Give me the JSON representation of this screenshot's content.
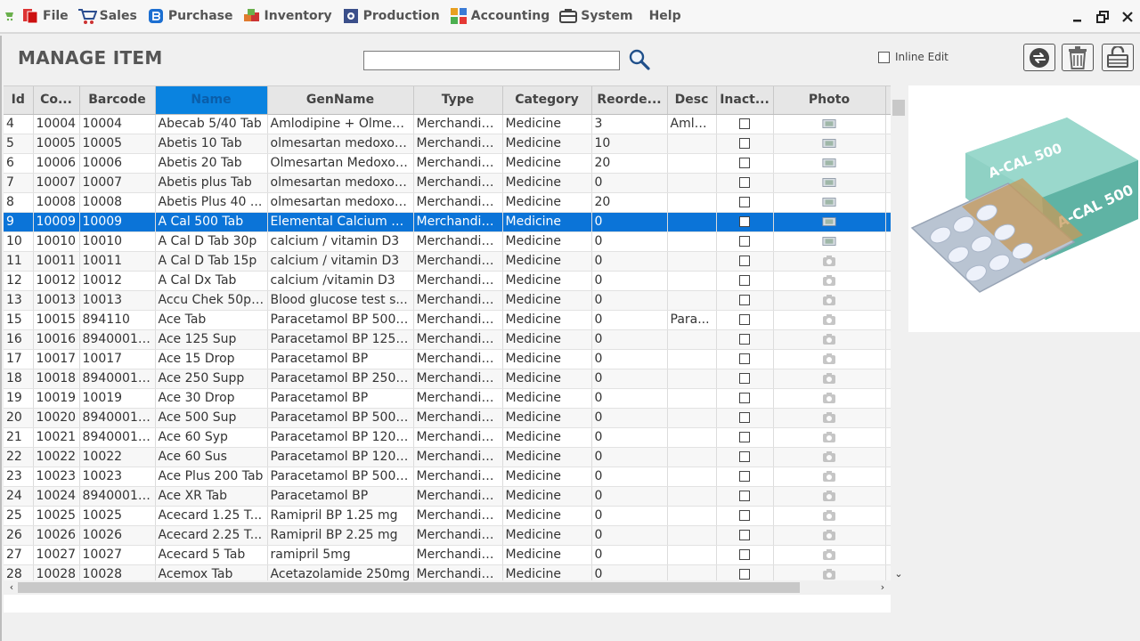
{
  "menu": {
    "items": [
      {
        "label": "File",
        "icon": "file-icon"
      },
      {
        "label": "Sales",
        "icon": "cart-icon"
      },
      {
        "label": "Purchase",
        "icon": "purchase-icon"
      },
      {
        "label": "Inventory",
        "icon": "inventory-icon"
      },
      {
        "label": "Production",
        "icon": "production-icon"
      },
      {
        "label": "Accounting",
        "icon": "accounting-icon"
      },
      {
        "label": "System",
        "icon": "system-icon"
      },
      {
        "label": "Help",
        "icon": ""
      }
    ]
  },
  "header": {
    "title": "MANAGE ITEM",
    "search_value": "",
    "inline_edit_label": "Inline Edit"
  },
  "grid": {
    "columns": [
      "Id",
      "Co...",
      "Barcode",
      "Name",
      "GenName",
      "Type",
      "Category",
      "Reorde...",
      "Desc",
      "Inact...",
      "Photo"
    ],
    "rows": [
      {
        "id": "4",
        "code": "10004",
        "barcode": "10004",
        "name": "Abecab 5/40 Tab",
        "gen": "Amlodipine + Olmesa...",
        "type": "Merchandis...",
        "cat": "Medicine",
        "reorder": "3",
        "desc": "Amlo...",
        "photo": "thumb"
      },
      {
        "id": "5",
        "code": "10005",
        "barcode": "10005",
        "name": "Abetis 10 Tab",
        "gen": "olmesartan medoxomil",
        "type": "Merchandis...",
        "cat": "Medicine",
        "reorder": "10",
        "desc": "",
        "photo": "thumb"
      },
      {
        "id": "6",
        "code": "10006",
        "barcode": "10006",
        "name": "Abetis 20 Tab",
        "gen": "Olmesartan Medoxomil",
        "type": "Merchandis...",
        "cat": "Medicine",
        "reorder": "20",
        "desc": "",
        "photo": "thumb"
      },
      {
        "id": "7",
        "code": "10007",
        "barcode": "10007",
        "name": "Abetis plus Tab",
        "gen": "olmesartan medoxomil",
        "type": "Merchandis...",
        "cat": "Medicine",
        "reorder": "0",
        "desc": "",
        "photo": "thumb"
      },
      {
        "id": "8",
        "code": "10008",
        "barcode": "10008",
        "name": "Abetis Plus 40 ...",
        "gen": "olmesartan medoxom...",
        "type": "Merchandis...",
        "cat": "Medicine",
        "reorder": "20",
        "desc": "",
        "photo": "thumb"
      },
      {
        "id": "9",
        "code": "10009",
        "barcode": "10009",
        "name": "A Cal 500 Tab",
        "gen": "Elemental Calcium 50...",
        "type": "Merchandis...",
        "cat": "Medicine",
        "reorder": "0",
        "desc": "",
        "photo": "thumb",
        "selected": true
      },
      {
        "id": "10",
        "code": "10010",
        "barcode": "10010",
        "name": "A Cal D Tab 30p",
        "gen": "calcium / vitamin D3",
        "type": "Merchandis...",
        "cat": "Medicine",
        "reorder": "0",
        "desc": "",
        "photo": "thumb"
      },
      {
        "id": "11",
        "code": "10011",
        "barcode": "10011",
        "name": "A Cal D Tab 15p",
        "gen": "calcium / vitamin D3",
        "type": "Merchandis...",
        "cat": "Medicine",
        "reorder": "0",
        "desc": "",
        "photo": "cam"
      },
      {
        "id": "12",
        "code": "10012",
        "barcode": "10012",
        "name": "A Cal Dx Tab",
        "gen": "calcium /vitamin D3",
        "type": "Merchandis...",
        "cat": "Medicine",
        "reorder": "0",
        "desc": "",
        "photo": "cam"
      },
      {
        "id": "13",
        "code": "10013",
        "barcode": "10013",
        "name": "Accu Chek 50p ...",
        "gen": "Blood glucose test s...",
        "type": "Merchandis...",
        "cat": "Medicine",
        "reorder": "0",
        "desc": "",
        "photo": "cam"
      },
      {
        "id": "15",
        "code": "10015",
        "barcode": "894110",
        "name": "Ace Tab",
        "gen": "Paracetamol BP 500 ...",
        "type": "Merchandis...",
        "cat": "Medicine",
        "reorder": "0",
        "desc": "Para...",
        "photo": "cam"
      },
      {
        "id": "16",
        "code": "10016",
        "barcode": "89400012...",
        "name": "Ace 125 Sup",
        "gen": "Paracetamol BP 125 ...",
        "type": "Merchandis...",
        "cat": "Medicine",
        "reorder": "0",
        "desc": "",
        "photo": "cam"
      },
      {
        "id": "17",
        "code": "10017",
        "barcode": "10017",
        "name": "Ace 15 Drop",
        "gen": "Paracetamol BP",
        "type": "Merchandis...",
        "cat": "Medicine",
        "reorder": "0",
        "desc": "",
        "photo": "cam"
      },
      {
        "id": "18",
        "code": "10018",
        "barcode": "89400012...",
        "name": "Ace 250 Supp",
        "gen": "Paracetamol BP 250 ...",
        "type": "Merchandis...",
        "cat": "Medicine",
        "reorder": "0",
        "desc": "",
        "photo": "cam"
      },
      {
        "id": "19",
        "code": "10019",
        "barcode": "10019",
        "name": "Ace 30 Drop",
        "gen": "Paracetamol BP",
        "type": "Merchandis...",
        "cat": "Medicine",
        "reorder": "0",
        "desc": "",
        "photo": "cam"
      },
      {
        "id": "20",
        "code": "10020",
        "barcode": "89400012...",
        "name": "Ace 500 Sup",
        "gen": "Paracetamol BP 500 ...",
        "type": "Merchandis...",
        "cat": "Medicine",
        "reorder": "0",
        "desc": "",
        "photo": "cam"
      },
      {
        "id": "21",
        "code": "10021",
        "barcode": "89400012...",
        "name": "Ace 60 Syp",
        "gen": "Paracetamol BP 120 ...",
        "type": "Merchandis...",
        "cat": "Medicine",
        "reorder": "0",
        "desc": "",
        "photo": "cam"
      },
      {
        "id": "22",
        "code": "10022",
        "barcode": "10022",
        "name": "Ace 60 Sus",
        "gen": "Paracetamol BP 120 ...",
        "type": "Merchandis...",
        "cat": "Medicine",
        "reorder": "0",
        "desc": "",
        "photo": "cam"
      },
      {
        "id": "23",
        "code": "10023",
        "barcode": "10023",
        "name": "Ace Plus 200 Tab",
        "gen": "Paracetamol BP 500 ...",
        "type": "Merchandis...",
        "cat": "Medicine",
        "reorder": "0",
        "desc": "",
        "photo": "cam"
      },
      {
        "id": "24",
        "code": "10024",
        "barcode": "89400012...",
        "name": "Ace XR Tab",
        "gen": "Paracetamol BP",
        "type": "Merchandis...",
        "cat": "Medicine",
        "reorder": "0",
        "desc": "",
        "photo": "cam"
      },
      {
        "id": "25",
        "code": "10025",
        "barcode": "10025",
        "name": "Acecard 1.25 T...",
        "gen": "Ramipril BP 1.25 mg",
        "type": "Merchandis...",
        "cat": "Medicine",
        "reorder": "0",
        "desc": "",
        "photo": "cam"
      },
      {
        "id": "26",
        "code": "10026",
        "barcode": "10026",
        "name": "Acecard 2.25 T...",
        "gen": "Ramipril BP 2.25 mg",
        "type": "Merchandis...",
        "cat": "Medicine",
        "reorder": "0",
        "desc": "",
        "photo": "cam"
      },
      {
        "id": "27",
        "code": "10027",
        "barcode": "10027",
        "name": "Acecard 5 Tab",
        "gen": "ramipril 5mg",
        "type": "Merchandis...",
        "cat": "Medicine",
        "reorder": "0",
        "desc": "",
        "photo": "cam"
      },
      {
        "id": "28",
        "code": "10028",
        "barcode": "10028",
        "name": "Acemox Tab",
        "gen": "Acetazolamide 250mg",
        "type": "Merchandis...",
        "cat": "Medicine",
        "reorder": "0",
        "desc": "",
        "photo": "cam"
      }
    ]
  },
  "preview": {
    "brand": "A-CAL 500",
    "colors": {
      "box": "#6fc1b0",
      "box_dark": "#3c9486",
      "blister": "#b9c4d2",
      "tablet": "#e9eef8"
    }
  },
  "colors": {
    "selection": "#0b74d8",
    "sorted_header": "#0a83e0"
  }
}
